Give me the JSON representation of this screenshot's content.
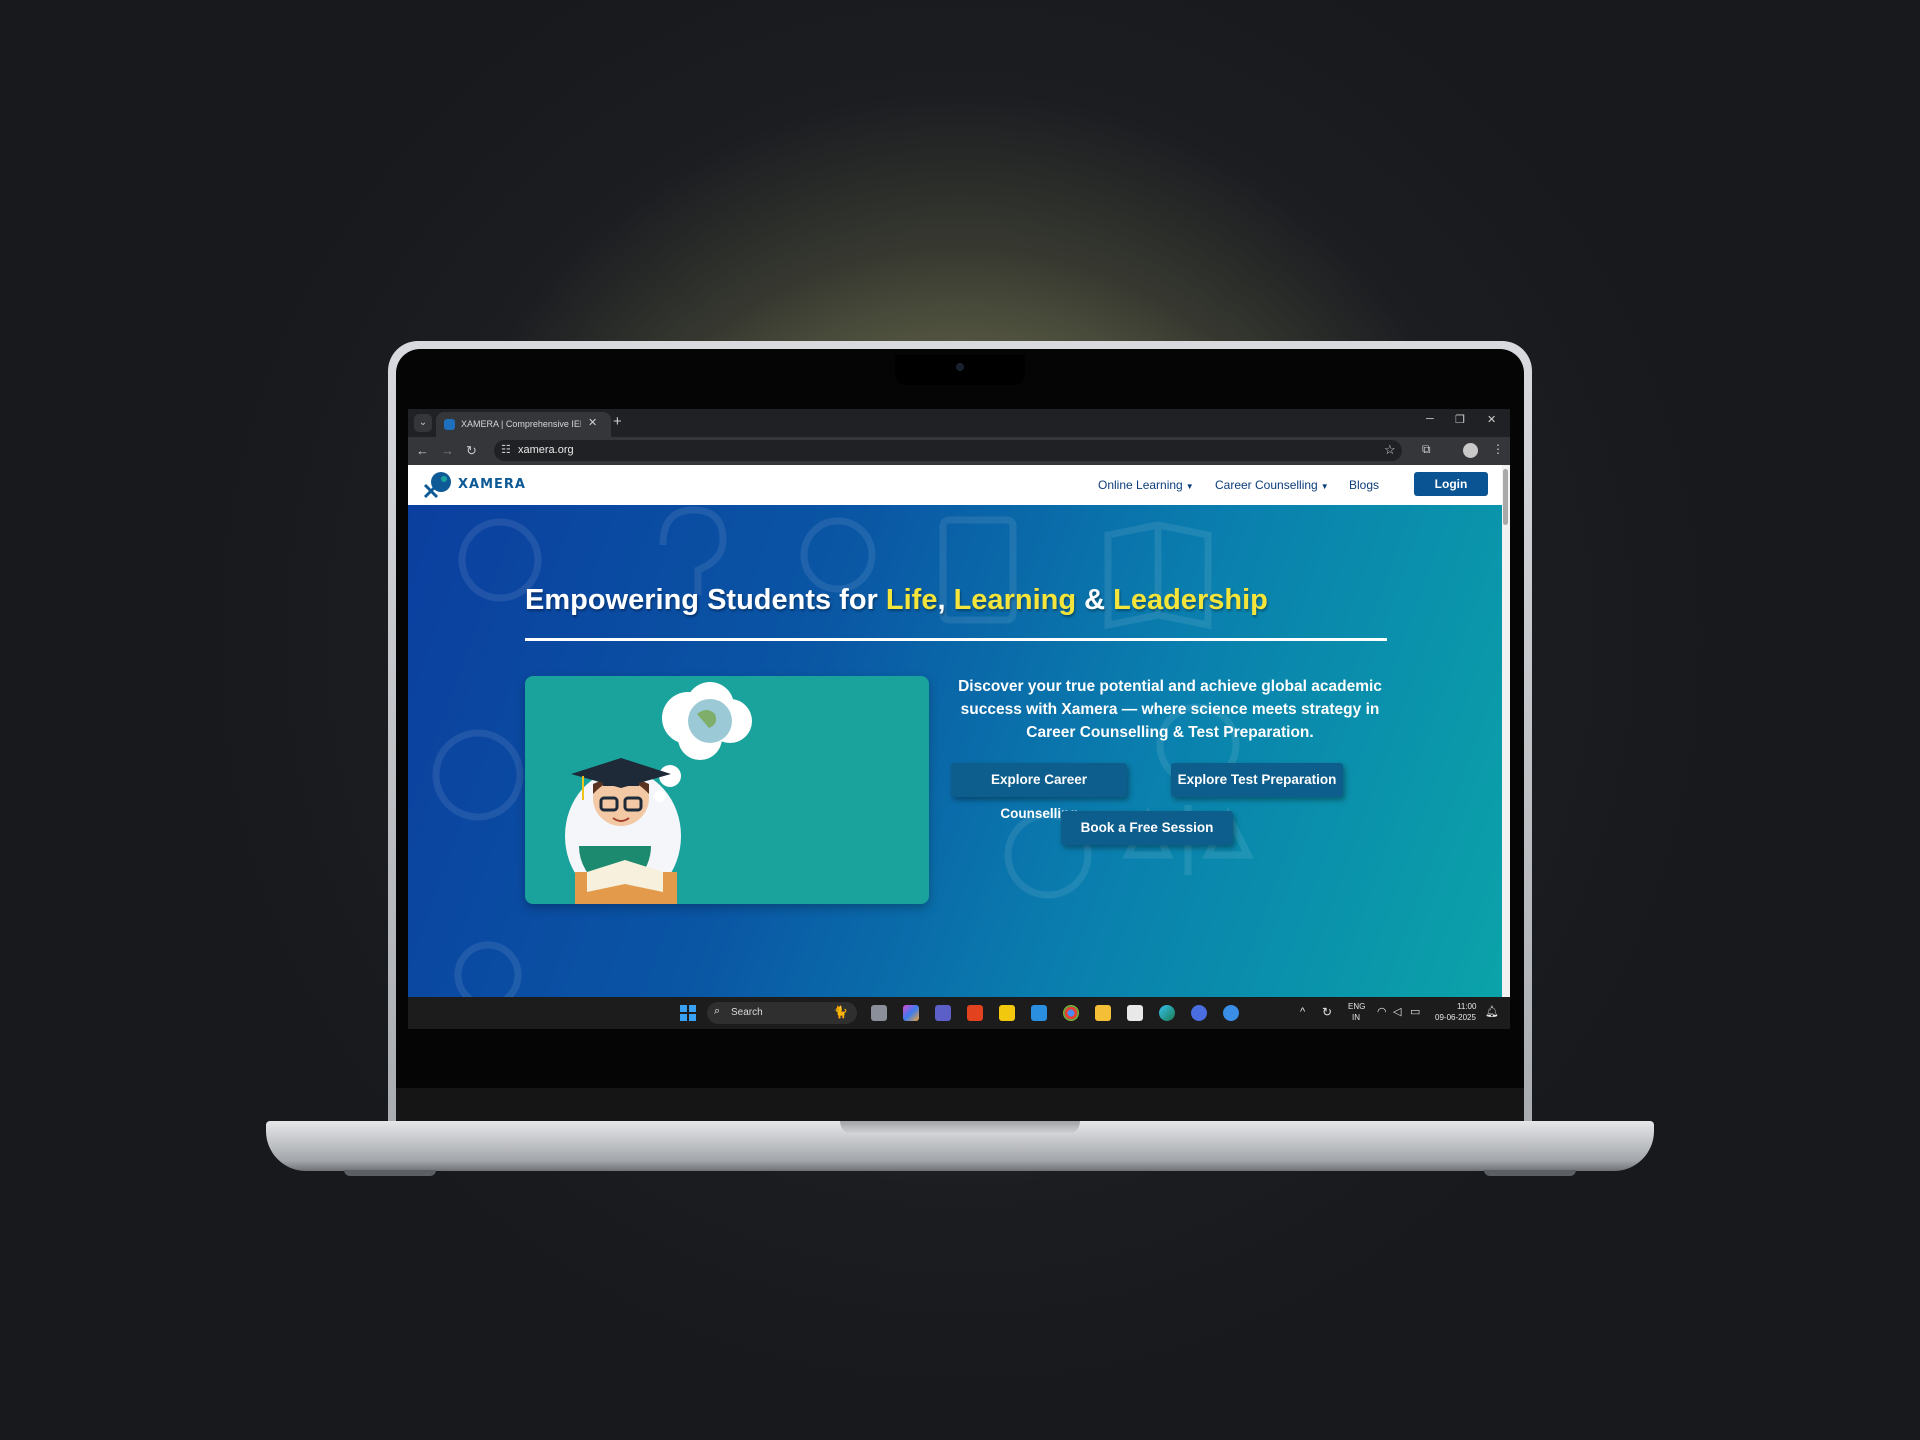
{
  "browser": {
    "tab_title": "XAMERA | Comprehensive IELTS",
    "url": "xamera.org",
    "icons": [
      "tab-search-icon",
      "close-icon",
      "new-tab-icon",
      "minimize-icon",
      "restore-icon",
      "back-icon",
      "forward-icon",
      "reload-icon",
      "site-info-icon",
      "bookmark-star-icon",
      "extensions-icon",
      "profile-icon",
      "menu-icon"
    ]
  },
  "site": {
    "logo": "XAMERA",
    "nav": {
      "online_learning": "Online Learning",
      "career_counselling": "Career Counselling",
      "blogs": "Blogs",
      "login": "Login"
    },
    "hero": {
      "headline_prefix": "Empowering Students for ",
      "word_1": "Life",
      "sep_1": ", ",
      "word_2": "Learning",
      "sep_2": " & ",
      "word_3": "Leadership",
      "intro": "Discover your true potential and achieve global academic success with Xamera — where science meets strategy in Career Counselling & Test Preparation.",
      "btn_career": "Explore Career Counselling",
      "btn_test": "Explore Test Preparation",
      "btn_session": "Book a Free Session"
    }
  },
  "taskbar": {
    "search_placeholder": "Search",
    "lang_top": "ENG",
    "lang_bottom": "IN",
    "time": "11:00",
    "date": "09-06-2025"
  },
  "colors": {
    "accent": "#0b5494",
    "highlight": "#f5e53a",
    "hero_start": "#0b3f9f",
    "hero_end": "#0ba3a9",
    "illustration_bg": "#1aa39c"
  }
}
